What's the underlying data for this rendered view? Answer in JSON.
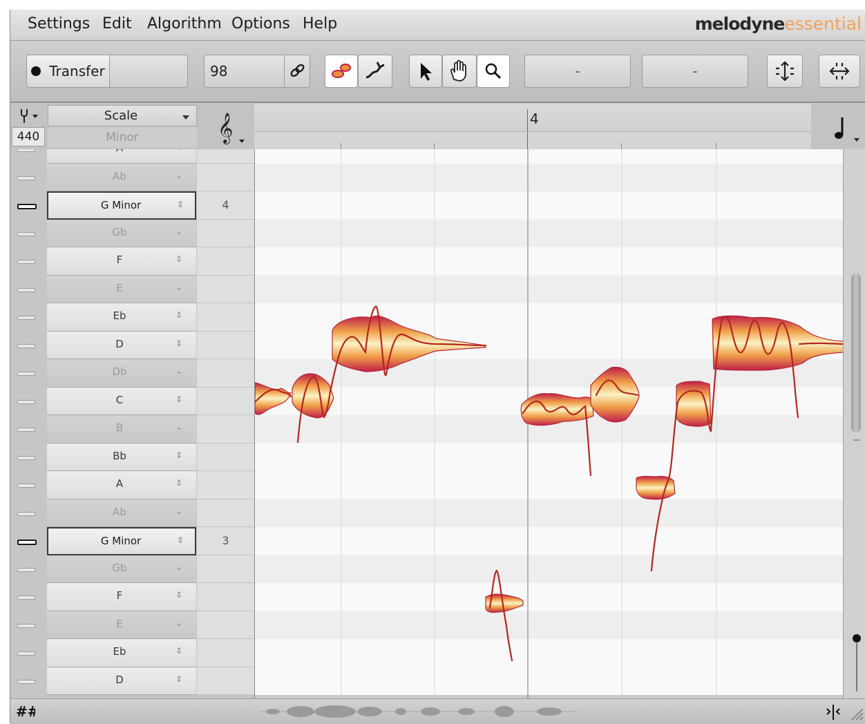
{
  "menu": {
    "items": [
      "Settings",
      "Edit",
      "Algorithm",
      "Options",
      "Help"
    ],
    "brand_main": "melodyne",
    "brand_edition": "essential"
  },
  "toolbar": {
    "transfer_label": "Transfer",
    "tempo_value": "98",
    "field1_value": "-",
    "field2_value": "-"
  },
  "header": {
    "tuning_reference": "440",
    "scale_label": "Scale",
    "scale_mode": "Minor",
    "bar_number": "4"
  },
  "pitch_rows": [
    {
      "note": "A",
      "type": "white",
      "dim": false,
      "key": "normal",
      "bar": ""
    },
    {
      "note": "Ab",
      "type": "grey",
      "dim": true,
      "key": "normal",
      "bar": ""
    },
    {
      "note": "G Minor",
      "type": "sel",
      "dim": false,
      "key": "strong",
      "bar": "4"
    },
    {
      "note": "Gb",
      "type": "grey",
      "dim": true,
      "key": "normal",
      "bar": ""
    },
    {
      "note": "F",
      "type": "white",
      "dim": false,
      "key": "normal",
      "bar": ""
    },
    {
      "note": "E",
      "type": "grey",
      "dim": true,
      "key": "normal",
      "bar": ""
    },
    {
      "note": "Eb",
      "type": "white",
      "dim": false,
      "key": "normal",
      "bar": ""
    },
    {
      "note": "D",
      "type": "white",
      "dim": false,
      "key": "normal",
      "bar": ""
    },
    {
      "note": "Db",
      "type": "grey",
      "dim": true,
      "key": "normal",
      "bar": ""
    },
    {
      "note": "C",
      "type": "white",
      "dim": false,
      "key": "normal",
      "bar": ""
    },
    {
      "note": "B",
      "type": "grey",
      "dim": true,
      "key": "normal",
      "bar": ""
    },
    {
      "note": "Bb",
      "type": "white",
      "dim": false,
      "key": "normal",
      "bar": ""
    },
    {
      "note": "A",
      "type": "white",
      "dim": false,
      "key": "normal",
      "bar": ""
    },
    {
      "note": "Ab",
      "type": "grey",
      "dim": true,
      "key": "normal",
      "bar": ""
    },
    {
      "note": "G Minor",
      "type": "sel",
      "dim": false,
      "key": "strong",
      "bar": "3"
    },
    {
      "note": "Gb",
      "type": "grey",
      "dim": true,
      "key": "normal",
      "bar": ""
    },
    {
      "note": "F",
      "type": "white",
      "dim": false,
      "key": "normal",
      "bar": ""
    },
    {
      "note": "E",
      "type": "grey",
      "dim": true,
      "key": "normal",
      "bar": ""
    },
    {
      "note": "Eb",
      "type": "white",
      "dim": false,
      "key": "normal",
      "bar": ""
    },
    {
      "note": "D",
      "type": "white",
      "dim": false,
      "key": "normal",
      "bar": ""
    }
  ],
  "colors": {
    "blob_outer": "#c0204a",
    "blob_mid": "#f0a04a",
    "blob_inner": "#fbf2c2",
    "pitch_curve": "#b3261e"
  }
}
